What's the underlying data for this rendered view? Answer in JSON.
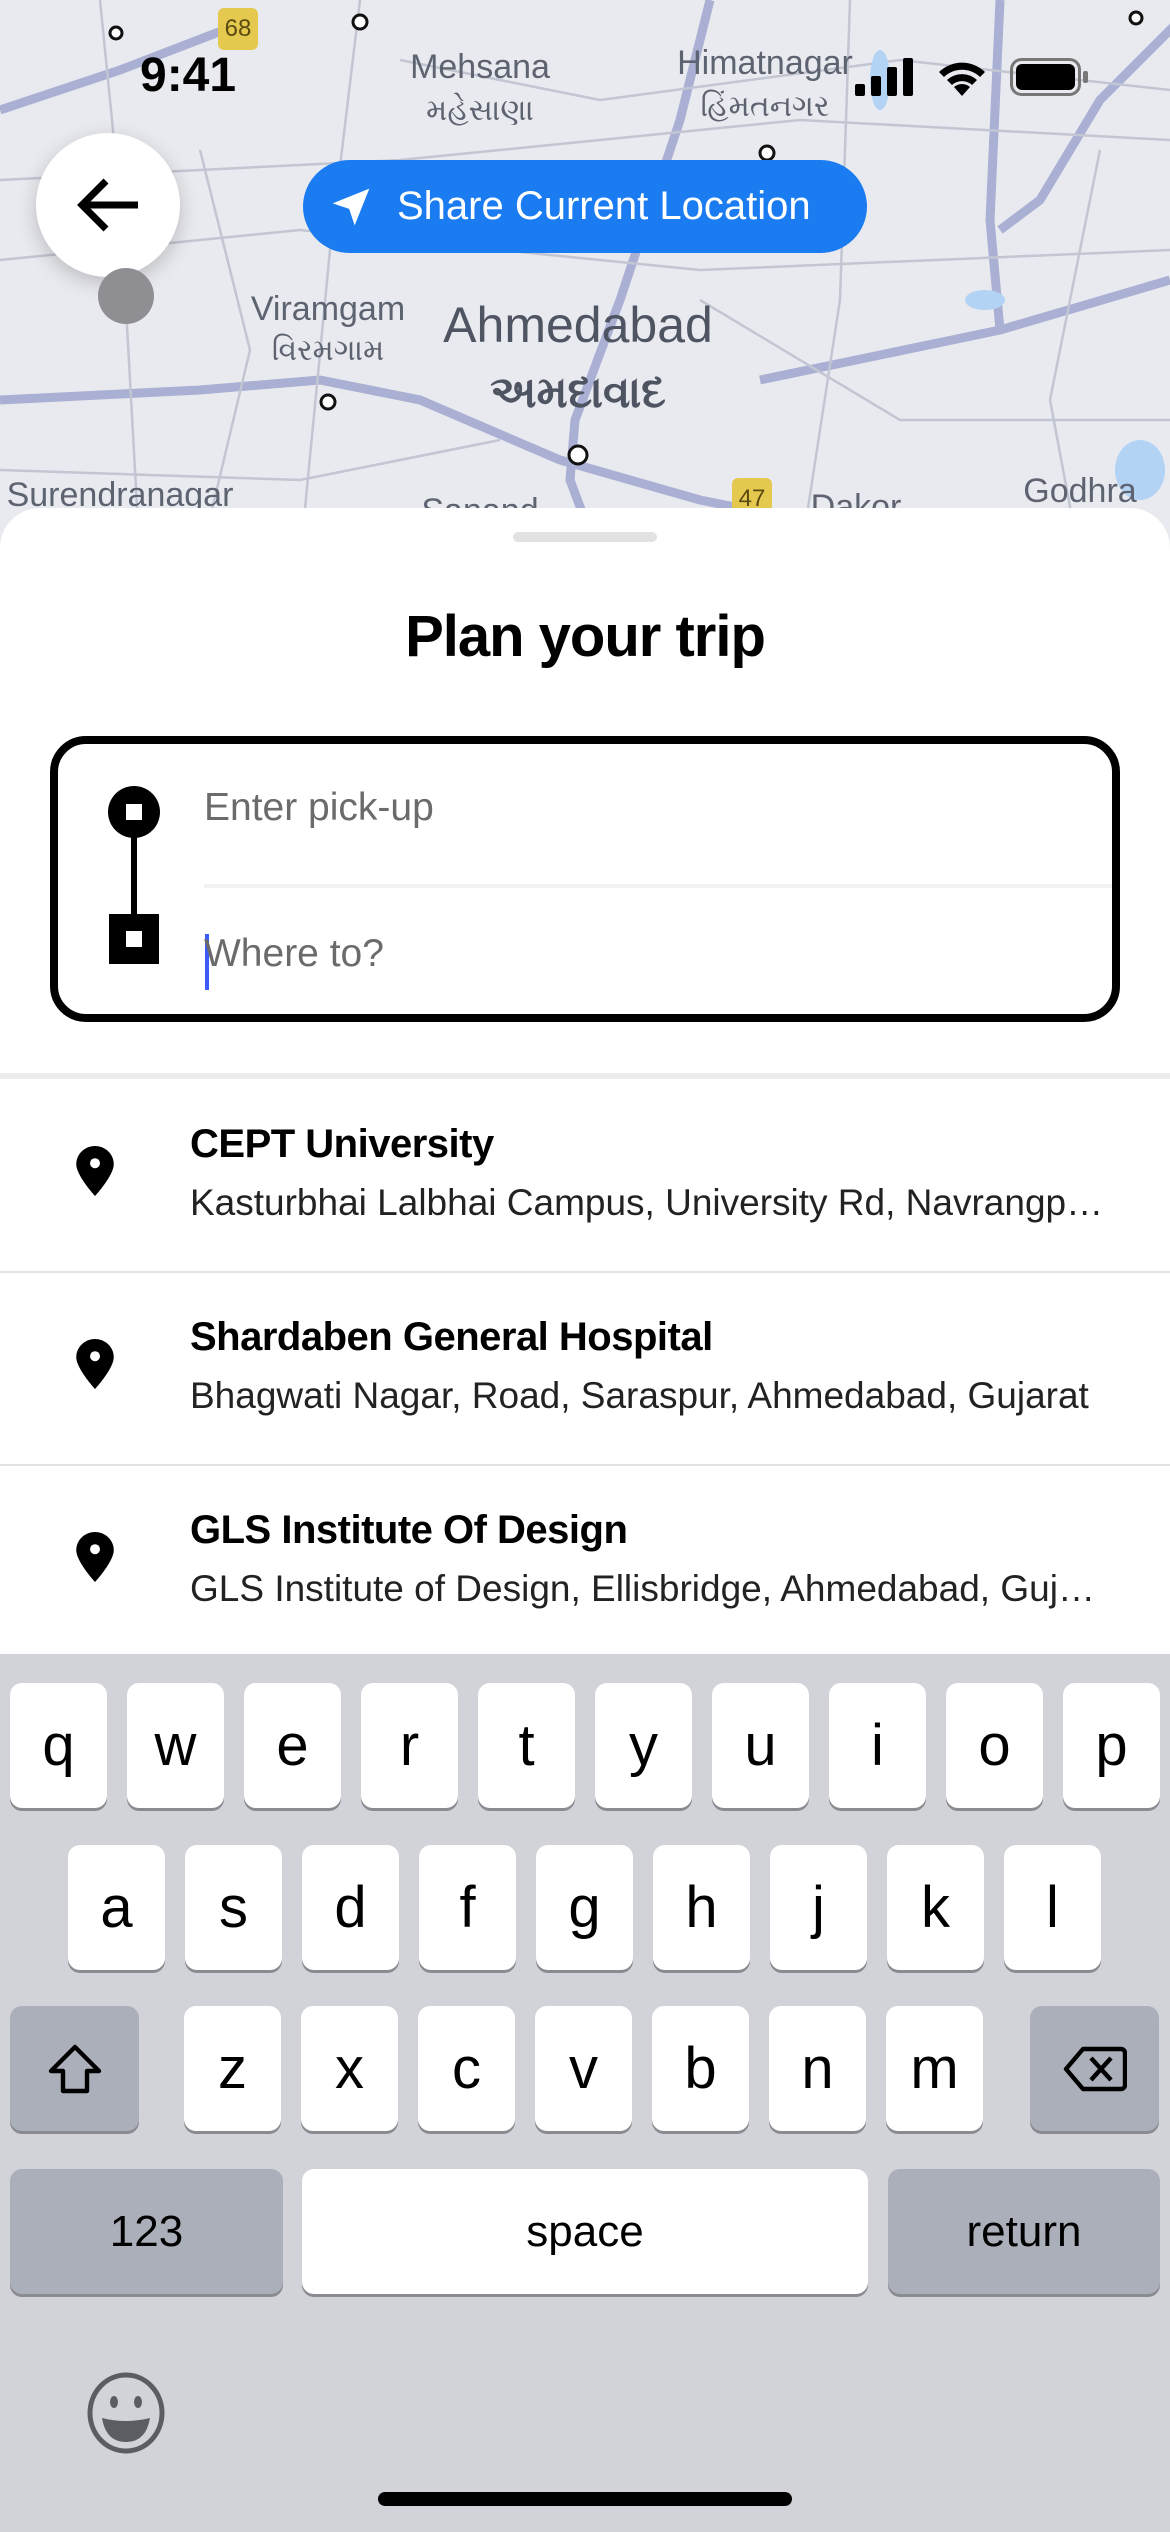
{
  "status_bar": {
    "time": "9:41"
  },
  "map": {
    "labels": [
      "Mehsana",
      "મહેસાણા",
      "Himatnagar",
      "હિંમતનગર",
      "Viramgam",
      "વિરમગામ",
      "Ahmedabad",
      "અમદાવાદ",
      "Surendranagar",
      "Sanand",
      "Dakor",
      "Godhra"
    ],
    "shields": [
      "68",
      "47"
    ]
  },
  "share_button": {
    "label": "Share Current Location",
    "color": "#1a7cf0"
  },
  "sheet": {
    "title": "Plan your trip",
    "pickup_placeholder": "Enter pick-up",
    "destination_placeholder": "Where to?"
  },
  "suggestions": [
    {
      "title": "CEPT University",
      "subtitle": "Kasturbhai Lalbhai Campus, University Rd, Navrangpura"
    },
    {
      "title": "Shardaben General Hospital",
      "subtitle": "Bhagwati Nagar, Road, Saraspur, Ahmedabad, Gujarat"
    },
    {
      "title": "GLS Institute Of Design",
      "subtitle": "GLS Institute of Design, Ellisbridge, Ahmedabad, Gujarat"
    }
  ],
  "keyboard": {
    "rows": [
      [
        "q",
        "w",
        "e",
        "r",
        "t",
        "y",
        "u",
        "i",
        "o",
        "p"
      ],
      [
        "a",
        "s",
        "d",
        "f",
        "g",
        "h",
        "j",
        "k",
        "l"
      ],
      [
        "z",
        "x",
        "c",
        "v",
        "b",
        "n",
        "m"
      ]
    ],
    "numbers": "123",
    "space": "space",
    "return": "return"
  }
}
